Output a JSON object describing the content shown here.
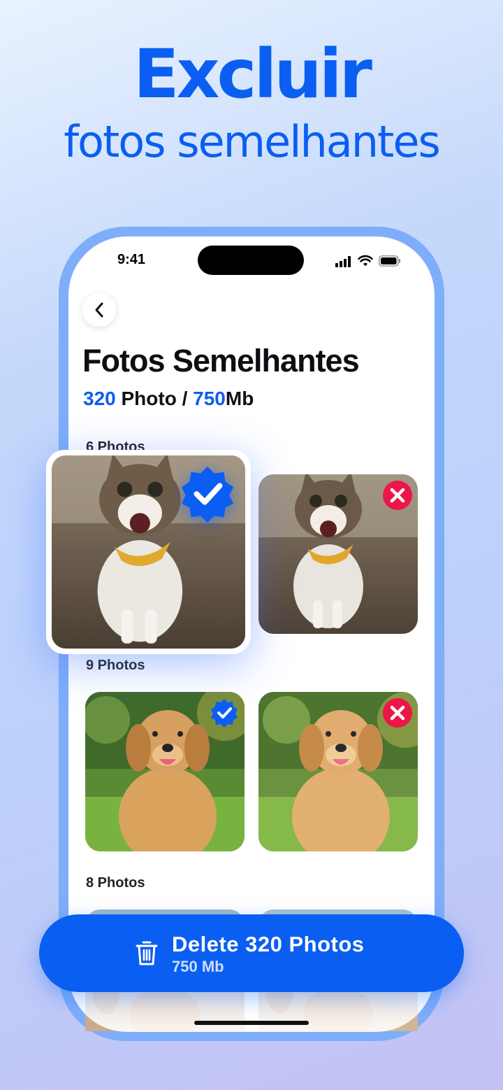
{
  "promo": {
    "headline": "Excluir",
    "subline": "fotos semelhantes"
  },
  "status_bar": {
    "time": "9:41",
    "icons": [
      "cellular-signal-icon",
      "wifi-icon",
      "battery-icon"
    ]
  },
  "header": {
    "back_icon": "chevron-left-icon",
    "title": "Fotos Semelhantes",
    "stats": {
      "photo_count": "320",
      "photo_label": " Photo / ",
      "size_value": "750",
      "size_unit": "Mb"
    }
  },
  "groups": [
    {
      "label": "6 Photos",
      "photos": [
        {
          "subject": "cat",
          "status": "keep",
          "badge_icon": "check-badge-icon"
        },
        {
          "subject": "cat",
          "status": "delete",
          "badge_icon": "close-icon"
        }
      ]
    },
    {
      "label": "9 Photos",
      "photos": [
        {
          "subject": "golden retriever",
          "status": "keep",
          "badge_icon": "check-badge-icon"
        },
        {
          "subject": "golden retriever",
          "status": "delete",
          "badge_icon": "close-icon"
        }
      ]
    },
    {
      "label": "8 Photos",
      "photos": [
        {
          "subject": "orange cat",
          "status": "keep"
        },
        {
          "subject": "orange cat",
          "status": "delete"
        }
      ]
    }
  ],
  "delete_button": {
    "icon": "trash-icon",
    "label": "Delete 320 Photos",
    "size": "750 Mb"
  },
  "colors": {
    "accent": "#0a5ef2",
    "delete_badge": "#ee1549",
    "phone_frame": "#7eadfa"
  }
}
